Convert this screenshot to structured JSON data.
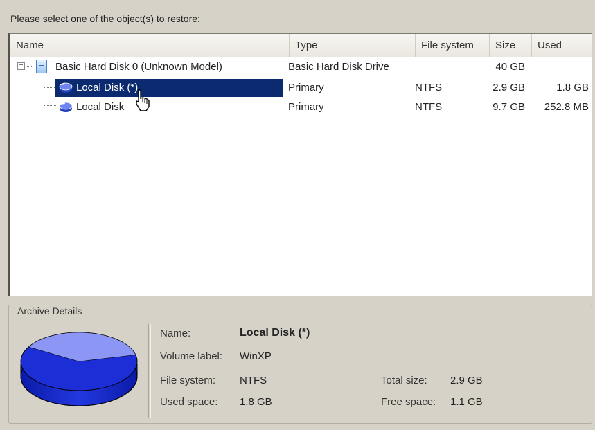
{
  "prompt": "Please select one of the object(s) to restore:",
  "columns": [
    "Name",
    "Type",
    "File system",
    "Size",
    "Used"
  ],
  "rows": [
    {
      "name": "Basic Hard Disk 0 (Unknown Model)",
      "type": "Basic Hard Disk Drive",
      "fs": "",
      "size": "40 GB",
      "used": "",
      "icon": "hard-disk-icon",
      "expander": "−"
    },
    {
      "name": "Local Disk (*)",
      "type": "Primary",
      "fs": "NTFS",
      "size": "2.9 GB",
      "used": "1.8 GB",
      "icon": "volume-icon",
      "selected": true
    },
    {
      "name": "Local Disk",
      "type": "Primary",
      "fs": "NTFS",
      "size": "9.7 GB",
      "used": "252.8 MB",
      "icon": "volume-icon"
    }
  ],
  "details": {
    "title": "Archive Details",
    "name_label": "Name:",
    "name_value": "Local Disk (*)",
    "volume_label": "Volume label:",
    "volume_value": "WinXP",
    "fs_label": "File system:",
    "fs_value": "NTFS",
    "used_label": "Used space:",
    "used_value": "1.8 GB",
    "total_label": "Total size:",
    "total_value": "2.9 GB",
    "free_label": "Free space:",
    "free_value": "1.1 GB",
    "pie_icon": "disk-usage-pie-icon",
    "used_fraction": 0.62,
    "colors": {
      "used": "#1c2fd6",
      "free": "#8c96f4"
    }
  },
  "colors": {
    "selection": "#0b2a6f",
    "background": "#d6d2c8"
  }
}
